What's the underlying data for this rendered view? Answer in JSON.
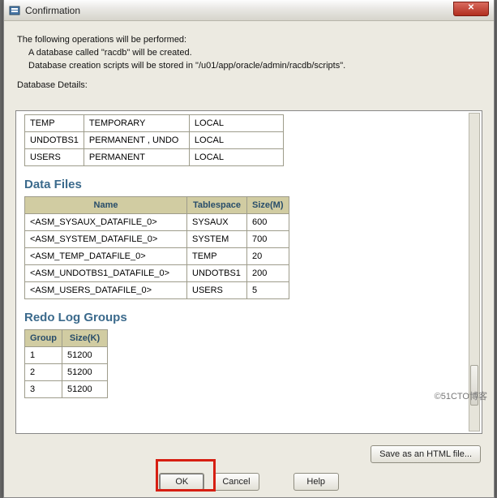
{
  "window": {
    "title": "Confirmation",
    "close_label": "×"
  },
  "intro": {
    "line1": "The following operations will be performed:",
    "line2": "A database called \"racdb\" will be created.",
    "line3": "Database creation scripts will be stored in \"/u01/app/oracle/admin/racdb/scripts\".",
    "details_heading": "Database Details:"
  },
  "db_details": {
    "rows": [
      {
        "name": "TEMP",
        "type": "TEMPORARY",
        "extent": "LOCAL"
      },
      {
        "name": "UNDOTBS1",
        "type": "PERMANENT , UNDO",
        "extent": "LOCAL"
      },
      {
        "name": "USERS",
        "type": "PERMANENT",
        "extent": "LOCAL"
      }
    ]
  },
  "data_files": {
    "heading": "Data Files",
    "columns": {
      "name": "Name",
      "tablespace": "Tablespace",
      "size": "Size(M)"
    },
    "rows": [
      {
        "name": "<ASM_SYSAUX_DATAFILE_0>",
        "tablespace": "SYSAUX",
        "size": "600"
      },
      {
        "name": "<ASM_SYSTEM_DATAFILE_0>",
        "tablespace": "SYSTEM",
        "size": "700"
      },
      {
        "name": "<ASM_TEMP_DATAFILE_0>",
        "tablespace": "TEMP",
        "size": "20"
      },
      {
        "name": "<ASM_UNDOTBS1_DATAFILE_0>",
        "tablespace": "UNDOTBS1",
        "size": "200"
      },
      {
        "name": "<ASM_USERS_DATAFILE_0>",
        "tablespace": "USERS",
        "size": "5"
      }
    ]
  },
  "redo_log": {
    "heading": "Redo Log Groups",
    "columns": {
      "group": "Group",
      "size": "Size(K)"
    },
    "rows": [
      {
        "group": "1",
        "size": "51200"
      },
      {
        "group": "2",
        "size": "51200"
      },
      {
        "group": "3",
        "size": "51200"
      }
    ]
  },
  "buttons": {
    "save": "Save as an HTML file...",
    "ok": "OK",
    "cancel": "Cancel",
    "help": "Help"
  },
  "watermark": "©51CTO博客"
}
